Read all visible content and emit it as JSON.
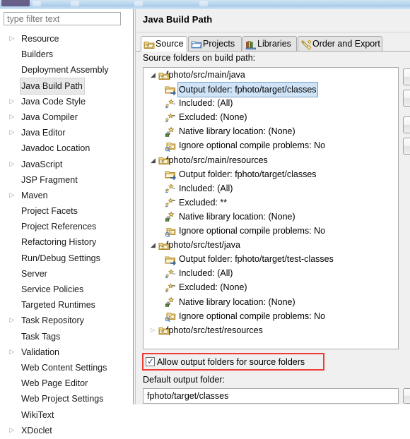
{
  "window": {
    "chrome_color": "#b9d6ee"
  },
  "sidebar": {
    "filter": {
      "placeholder": "type filter text",
      "value": ""
    },
    "items": [
      {
        "label": "Resource",
        "expandable": true,
        "selected": false
      },
      {
        "label": "Builders",
        "expandable": false,
        "selected": false
      },
      {
        "label": "Deployment Assembly",
        "expandable": false,
        "selected": false
      },
      {
        "label": "Java Build Path",
        "expandable": false,
        "selected": true
      },
      {
        "label": "Java Code Style",
        "expandable": true,
        "selected": false
      },
      {
        "label": "Java Compiler",
        "expandable": true,
        "selected": false
      },
      {
        "label": "Java Editor",
        "expandable": true,
        "selected": false
      },
      {
        "label": "Javadoc Location",
        "expandable": false,
        "selected": false
      },
      {
        "label": "JavaScript",
        "expandable": true,
        "selected": false
      },
      {
        "label": "JSP Fragment",
        "expandable": false,
        "selected": false
      },
      {
        "label": "Maven",
        "expandable": true,
        "selected": false
      },
      {
        "label": "Project Facets",
        "expandable": false,
        "selected": false
      },
      {
        "label": "Project References",
        "expandable": false,
        "selected": false
      },
      {
        "label": "Refactoring History",
        "expandable": false,
        "selected": false
      },
      {
        "label": "Run/Debug Settings",
        "expandable": false,
        "selected": false
      },
      {
        "label": "Server",
        "expandable": false,
        "selected": false
      },
      {
        "label": "Service Policies",
        "expandable": false,
        "selected": false
      },
      {
        "label": "Targeted Runtimes",
        "expandable": false,
        "selected": false
      },
      {
        "label": "Task Repository",
        "expandable": true,
        "selected": false
      },
      {
        "label": "Task Tags",
        "expandable": false,
        "selected": false
      },
      {
        "label": "Validation",
        "expandable": true,
        "selected": false
      },
      {
        "label": "Web Content Settings",
        "expandable": false,
        "selected": false
      },
      {
        "label": "Web Page Editor",
        "expandable": false,
        "selected": false
      },
      {
        "label": "Web Project Settings",
        "expandable": false,
        "selected": false
      },
      {
        "label": "WikiText",
        "expandable": false,
        "selected": false
      },
      {
        "label": "XDoclet",
        "expandable": true,
        "selected": false
      }
    ]
  },
  "page": {
    "title": "Java Build Path",
    "tabs": [
      {
        "label": "Source",
        "icon": "source-folder-icon",
        "active": true
      },
      {
        "label": "Projects",
        "icon": "project-folder-icon",
        "active": false
      },
      {
        "label": "Libraries",
        "icon": "library-books-icon",
        "active": false
      },
      {
        "label": "Order and Export",
        "icon": "order-export-icon",
        "active": false
      }
    ],
    "source_folders_label": "Source folders on build path:",
    "tree": [
      {
        "level": 0,
        "label": "fphoto/src/main/java",
        "icon": "source-folder-icon",
        "twisty": "expanded",
        "selected": false
      },
      {
        "level": 1,
        "label": "Output folder: fphoto/target/classes",
        "icon": "output-folder-icon",
        "twisty": "none",
        "selected": true
      },
      {
        "level": 1,
        "label": "Included: (All)",
        "icon": "included-filter-icon",
        "twisty": "none",
        "selected": false
      },
      {
        "level": 1,
        "label": "Excluded: (None)",
        "icon": "excluded-filter-icon",
        "twisty": "none",
        "selected": false
      },
      {
        "level": 1,
        "label": "Native library location: (None)",
        "icon": "native-library-icon",
        "twisty": "none",
        "selected": false
      },
      {
        "level": 1,
        "label": "Ignore optional compile problems: No",
        "icon": "compile-problems-icon",
        "twisty": "none",
        "selected": false
      },
      {
        "level": 0,
        "label": "fphoto/src/main/resources",
        "icon": "source-folder-icon",
        "twisty": "expanded",
        "selected": false
      },
      {
        "level": 1,
        "label": "Output folder: fphoto/target/classes",
        "icon": "output-folder-icon",
        "twisty": "none",
        "selected": false
      },
      {
        "level": 1,
        "label": "Included: (All)",
        "icon": "included-filter-icon",
        "twisty": "none",
        "selected": false
      },
      {
        "level": 1,
        "label": "Excluded: **",
        "icon": "excluded-filter-icon",
        "twisty": "none",
        "selected": false
      },
      {
        "level": 1,
        "label": "Native library location: (None)",
        "icon": "native-library-icon",
        "twisty": "none",
        "selected": false
      },
      {
        "level": 1,
        "label": "Ignore optional compile problems: No",
        "icon": "compile-problems-icon",
        "twisty": "none",
        "selected": false
      },
      {
        "level": 0,
        "label": "fphoto/src/test/java",
        "icon": "source-folder-icon",
        "twisty": "expanded",
        "selected": false
      },
      {
        "level": 1,
        "label": "Output folder: fphoto/target/test-classes",
        "icon": "output-folder-icon",
        "twisty": "none",
        "selected": false
      },
      {
        "level": 1,
        "label": "Included: (All)",
        "icon": "included-filter-icon",
        "twisty": "none",
        "selected": false
      },
      {
        "level": 1,
        "label": "Excluded: (None)",
        "icon": "excluded-filter-icon",
        "twisty": "none",
        "selected": false
      },
      {
        "level": 1,
        "label": "Native library location: (None)",
        "icon": "native-library-icon",
        "twisty": "none",
        "selected": false
      },
      {
        "level": 1,
        "label": "Ignore optional compile problems: No",
        "icon": "compile-problems-icon",
        "twisty": "none",
        "selected": false
      },
      {
        "level": 0,
        "label": "fphoto/src/test/resources",
        "icon": "source-folder-icon",
        "twisty": "collapsed",
        "selected": false
      }
    ],
    "side_buttons": [
      {
        "name": "add-folder-button"
      },
      {
        "name": "link-source-button"
      },
      {
        "name": "edit-button"
      },
      {
        "name": "remove-button"
      }
    ],
    "allow_output_folders": {
      "label": "Allow output folders for source folders",
      "checked": true,
      "highlight_color": "#ef3b35"
    },
    "default_output": {
      "label": "Default output folder:",
      "value": "fphoto/target/classes",
      "browse_label": ""
    }
  }
}
